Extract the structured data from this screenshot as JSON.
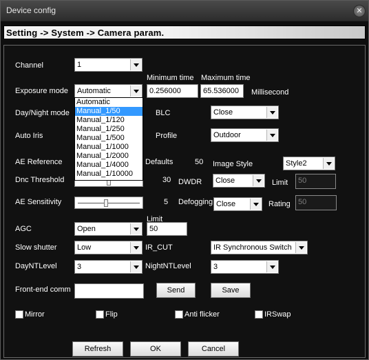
{
  "window": {
    "title": "Device config",
    "close_glyph": "✕"
  },
  "breadcrumb": "Setting -> System -> Camera param.",
  "channel": {
    "label": "Channel",
    "value": "1"
  },
  "exposure": {
    "label": "Exposure mode",
    "value": "Automatic",
    "min_label": "Minimum time",
    "max_label": "Maximum time",
    "min_value": "0.256000",
    "max_value": "65.536000",
    "unit": "Millisecond",
    "options": [
      "Automatic",
      "Manual_1/50",
      "Manual_1/120",
      "Manual_1/250",
      "Manual_1/500",
      "Manual_1/1000",
      "Manual_1/2000",
      "Manual_1/4000",
      "Manual_1/10000"
    ],
    "highlighted_option": "Manual_1/50"
  },
  "day_night": {
    "label": "Day/Night mode"
  },
  "blc": {
    "label": "BLC",
    "value": "Close"
  },
  "auto_iris": {
    "label": "Auto Iris"
  },
  "profile": {
    "label": "Profile",
    "value": "Outdoor"
  },
  "ae_reference": {
    "label": "AE Reference",
    "defaults_label": "Defaults",
    "value": "50"
  },
  "image_style": {
    "label": "Image Style",
    "value": "Style2"
  },
  "dnc_threshold": {
    "label": "Dnc Threshold",
    "value": "30"
  },
  "dwdr": {
    "label": "DWDR",
    "value": "Close",
    "limit_label": "Limit",
    "limit_value": "50"
  },
  "ae_sensitivity": {
    "label": "AE Sensitivity",
    "value": "5",
    "level": 0.45
  },
  "defogging": {
    "label": "Defogging",
    "value": "Close",
    "rating_label": "Rating",
    "rating_value": "50"
  },
  "agc": {
    "label": "AGC",
    "value": "Open",
    "limit_label": "Limit",
    "limit_value": "50"
  },
  "slow_shutter": {
    "label": "Slow shutter",
    "value": "Low"
  },
  "ir_cut": {
    "label": "IR_CUT",
    "value": "IR Synchronous Switch"
  },
  "day_nt_level": {
    "label": "DayNTLevel",
    "value": "3"
  },
  "night_nt_level": {
    "label": "NightNTLevel",
    "value": "3"
  },
  "front_end": {
    "label": "Front-end comm",
    "value": "",
    "send_label": "Send",
    "save_label": "Save"
  },
  "checkboxes": {
    "mirror": "Mirror",
    "flip": "Flip",
    "anti_flicker": "Anti flicker",
    "irswap": "IRSwap"
  },
  "footer": {
    "refresh": "Refresh",
    "ok": "OK",
    "cancel": "Cancel"
  }
}
